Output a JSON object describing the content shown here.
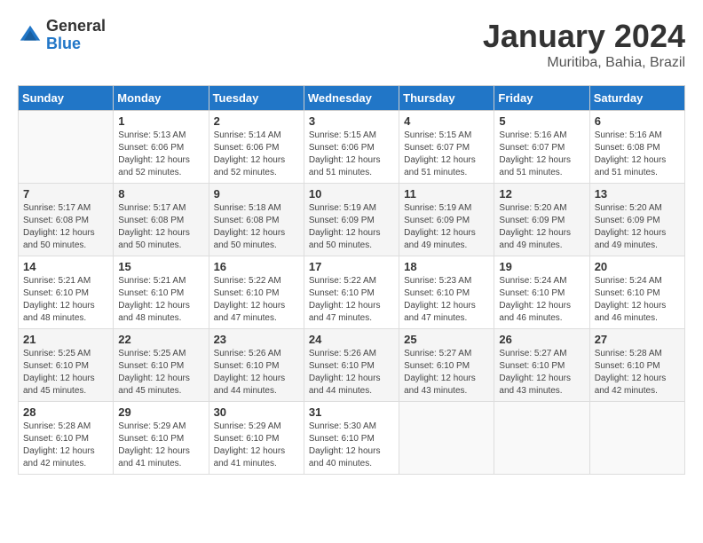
{
  "logo": {
    "general": "General",
    "blue": "Blue"
  },
  "title": "January 2024",
  "location": "Muritiba, Bahia, Brazil",
  "weekdays": [
    "Sunday",
    "Monday",
    "Tuesday",
    "Wednesday",
    "Thursday",
    "Friday",
    "Saturday"
  ],
  "weeks": [
    [
      {
        "day": "",
        "empty": true
      },
      {
        "day": "1",
        "sunrise": "5:13 AM",
        "sunset": "6:06 PM",
        "daylight": "12 hours and 52 minutes."
      },
      {
        "day": "2",
        "sunrise": "5:14 AM",
        "sunset": "6:06 PM",
        "daylight": "12 hours and 52 minutes."
      },
      {
        "day": "3",
        "sunrise": "5:15 AM",
        "sunset": "6:06 PM",
        "daylight": "12 hours and 51 minutes."
      },
      {
        "day": "4",
        "sunrise": "5:15 AM",
        "sunset": "6:07 PM",
        "daylight": "12 hours and 51 minutes."
      },
      {
        "day": "5",
        "sunrise": "5:16 AM",
        "sunset": "6:07 PM",
        "daylight": "12 hours and 51 minutes."
      },
      {
        "day": "6",
        "sunrise": "5:16 AM",
        "sunset": "6:08 PM",
        "daylight": "12 hours and 51 minutes."
      }
    ],
    [
      {
        "day": "7",
        "sunrise": "5:17 AM",
        "sunset": "6:08 PM",
        "daylight": "12 hours and 50 minutes."
      },
      {
        "day": "8",
        "sunrise": "5:17 AM",
        "sunset": "6:08 PM",
        "daylight": "12 hours and 50 minutes."
      },
      {
        "day": "9",
        "sunrise": "5:18 AM",
        "sunset": "6:08 PM",
        "daylight": "12 hours and 50 minutes."
      },
      {
        "day": "10",
        "sunrise": "5:19 AM",
        "sunset": "6:09 PM",
        "daylight": "12 hours and 50 minutes."
      },
      {
        "day": "11",
        "sunrise": "5:19 AM",
        "sunset": "6:09 PM",
        "daylight": "12 hours and 49 minutes."
      },
      {
        "day": "12",
        "sunrise": "5:20 AM",
        "sunset": "6:09 PM",
        "daylight": "12 hours and 49 minutes."
      },
      {
        "day": "13",
        "sunrise": "5:20 AM",
        "sunset": "6:09 PM",
        "daylight": "12 hours and 49 minutes."
      }
    ],
    [
      {
        "day": "14",
        "sunrise": "5:21 AM",
        "sunset": "6:10 PM",
        "daylight": "12 hours and 48 minutes."
      },
      {
        "day": "15",
        "sunrise": "5:21 AM",
        "sunset": "6:10 PM",
        "daylight": "12 hours and 48 minutes."
      },
      {
        "day": "16",
        "sunrise": "5:22 AM",
        "sunset": "6:10 PM",
        "daylight": "12 hours and 47 minutes."
      },
      {
        "day": "17",
        "sunrise": "5:22 AM",
        "sunset": "6:10 PM",
        "daylight": "12 hours and 47 minutes."
      },
      {
        "day": "18",
        "sunrise": "5:23 AM",
        "sunset": "6:10 PM",
        "daylight": "12 hours and 47 minutes."
      },
      {
        "day": "19",
        "sunrise": "5:24 AM",
        "sunset": "6:10 PM",
        "daylight": "12 hours and 46 minutes."
      },
      {
        "day": "20",
        "sunrise": "5:24 AM",
        "sunset": "6:10 PM",
        "daylight": "12 hours and 46 minutes."
      }
    ],
    [
      {
        "day": "21",
        "sunrise": "5:25 AM",
        "sunset": "6:10 PM",
        "daylight": "12 hours and 45 minutes."
      },
      {
        "day": "22",
        "sunrise": "5:25 AM",
        "sunset": "6:10 PM",
        "daylight": "12 hours and 45 minutes."
      },
      {
        "day": "23",
        "sunrise": "5:26 AM",
        "sunset": "6:10 PM",
        "daylight": "12 hours and 44 minutes."
      },
      {
        "day": "24",
        "sunrise": "5:26 AM",
        "sunset": "6:10 PM",
        "daylight": "12 hours and 44 minutes."
      },
      {
        "day": "25",
        "sunrise": "5:27 AM",
        "sunset": "6:10 PM",
        "daylight": "12 hours and 43 minutes."
      },
      {
        "day": "26",
        "sunrise": "5:27 AM",
        "sunset": "6:10 PM",
        "daylight": "12 hours and 43 minutes."
      },
      {
        "day": "27",
        "sunrise": "5:28 AM",
        "sunset": "6:10 PM",
        "daylight": "12 hours and 42 minutes."
      }
    ],
    [
      {
        "day": "28",
        "sunrise": "5:28 AM",
        "sunset": "6:10 PM",
        "daylight": "12 hours and 42 minutes."
      },
      {
        "day": "29",
        "sunrise": "5:29 AM",
        "sunset": "6:10 PM",
        "daylight": "12 hours and 41 minutes."
      },
      {
        "day": "30",
        "sunrise": "5:29 AM",
        "sunset": "6:10 PM",
        "daylight": "12 hours and 41 minutes."
      },
      {
        "day": "31",
        "sunrise": "5:30 AM",
        "sunset": "6:10 PM",
        "daylight": "12 hours and 40 minutes."
      },
      {
        "day": "",
        "empty": true
      },
      {
        "day": "",
        "empty": true
      },
      {
        "day": "",
        "empty": true
      }
    ]
  ],
  "labels": {
    "sunrise": "Sunrise:",
    "sunset": "Sunset:",
    "daylight": "Daylight:"
  }
}
